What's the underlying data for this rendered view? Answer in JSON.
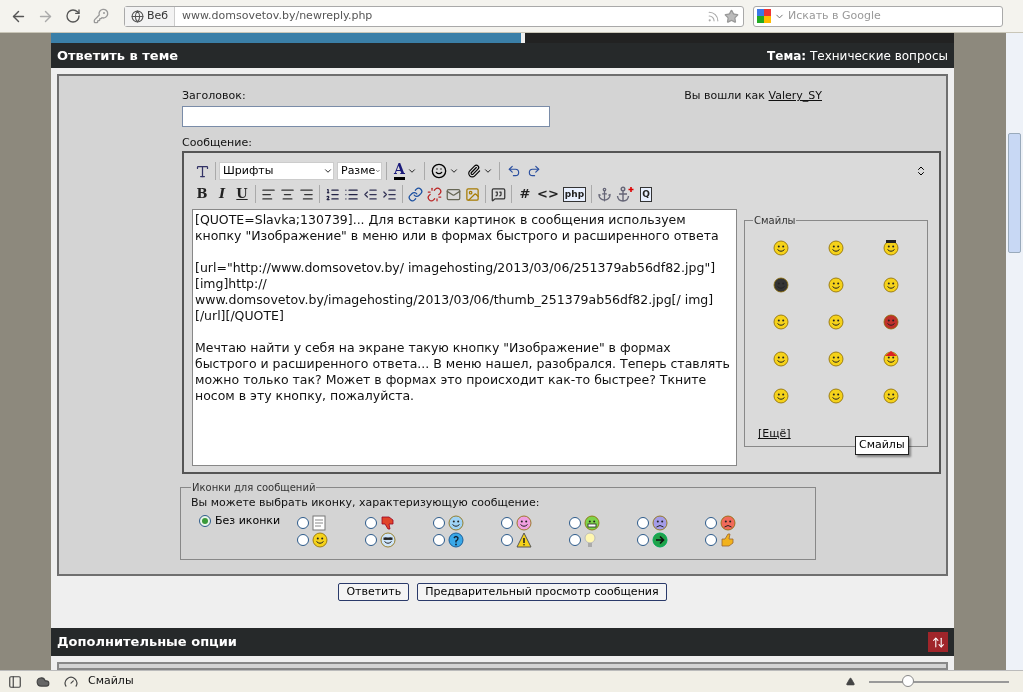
{
  "browser": {
    "engine_button": "Веб",
    "url": "www.domsovetov.by/newreply.php",
    "search_placeholder": "Искать в Google"
  },
  "header": {
    "title": "Ответить в теме",
    "topic": "**Тема:** Технические вопросы"
  },
  "form": {
    "title_label": "Заголовок:",
    "login_prefix": "Вы вошли как",
    "login_user": "Valery_SY",
    "message_label": "Сообщение:"
  },
  "editor": {
    "font_select": "Шрифты",
    "size_select": "Разме",
    "color_button": "A",
    "row_2": [
      {
        "kind": "bold",
        "label": "B"
      },
      {
        "kind": "italic",
        "label": "I"
      },
      {
        "kind": "underline",
        "label": "U"
      },
      {
        "kind": "sep"
      },
      {
        "kind": "align-left"
      },
      {
        "kind": "align-center"
      },
      {
        "kind": "align-right"
      },
      {
        "kind": "sep"
      },
      {
        "kind": "ordered-list"
      },
      {
        "kind": "list"
      },
      {
        "kind": "outdent"
      },
      {
        "kind": "indent"
      },
      {
        "kind": "sep"
      },
      {
        "kind": "link"
      },
      {
        "kind": "unlink"
      },
      {
        "kind": "email"
      },
      {
        "kind": "image"
      },
      {
        "kind": "sep"
      },
      {
        "kind": "quote"
      },
      {
        "kind": "sep"
      },
      {
        "kind": "text",
        "label": "#"
      },
      {
        "kind": "text",
        "label": "<>"
      },
      {
        "kind": "boxed",
        "label": "php"
      },
      {
        "kind": "sep"
      },
      {
        "kind": "anchor"
      },
      {
        "kind": "anchor-add"
      },
      {
        "kind": "boxed",
        "label": "Q"
      }
    ],
    "value": "[QUOTE=Slavka;130739]... Для вставки картинок в сообщения используем кнопку \"Изображение\" в меню или в формах быстрого и расширенного ответа\n\n[url=\"http://www.domsovetov.by/ imagehosting/2013/03/06/251379ab56df82.jpg\"][img]http:// www.domsovetov.by/imagehosting/2013/03/06/thumb_251379ab56df82.jpg[/ img][/url][/QUOTE]\n\nМечтаю найти у себя на экране такую кнопку \"Изображение\" в формах быстрого и расширенного ответа... В меню нашел, разобрался. Теперь ставлять можно только так? Может в формах это происходит как-то быстрее? Ткните носом в эту кнопку, пожалуйста.",
    "smilies_legend": "Смайлы",
    "more_link": "[Ещё]",
    "tooltip": "Смайлы"
  },
  "message_icons": {
    "legend": "Иконки для сообщений",
    "prompt": "Вы можете выбрать иконку, характеризующую сообщение:",
    "options": [
      {
        "kind": "none",
        "label": "Без иконки",
        "selected": true
      },
      {
        "kind": "document",
        "selected": false
      },
      {
        "kind": "thumbs-down",
        "selected": false
      },
      {
        "kind": "wink",
        "selected": false
      },
      {
        "kind": "pink-smile",
        "selected": false
      },
      {
        "kind": "grin",
        "selected": false
      },
      {
        "kind": "sad",
        "selected": false
      },
      {
        "kind": "angry",
        "selected": false
      },
      {
        "kind": "smile",
        "selected": false
      },
      {
        "kind": "cool",
        "selected": false
      },
      {
        "kind": "question",
        "selected": false
      },
      {
        "kind": "warning",
        "selected": false
      },
      {
        "kind": "lightbulb",
        "selected": false
      },
      {
        "kind": "arrow",
        "selected": false
      },
      {
        "kind": "thumbs-up",
        "selected": false
      }
    ]
  },
  "buttons": [
    "Ответить",
    "Предварительный просмотр сообщения"
  ],
  "options_header": "Дополнительные опции",
  "status_bar": {
    "text": "Смайлы",
    "zoom": {
      "level": 0.28
    }
  }
}
